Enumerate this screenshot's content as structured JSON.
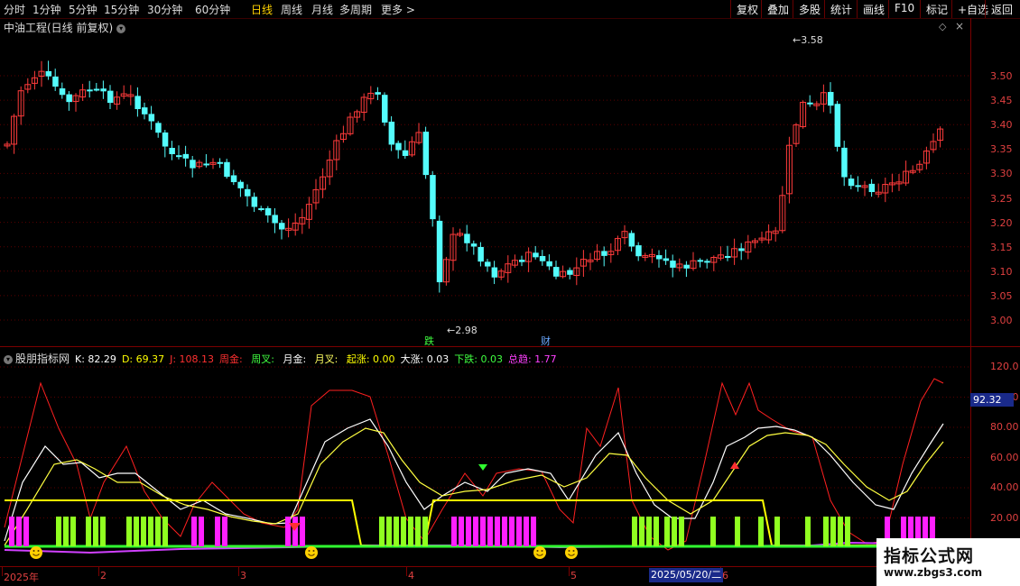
{
  "toolbar": {
    "left": [
      "分时",
      "1分钟",
      "5分钟",
      "15分钟",
      "30分钟",
      "60分钟",
      "日线",
      "周线",
      "月线",
      "多周期",
      "更多 >"
    ],
    "active": "日线",
    "right": [
      "复权",
      "叠加",
      "多股",
      "统计",
      "画线",
      "F10",
      "标记",
      "+自选",
      "返回"
    ]
  },
  "main_chart": {
    "title": "中油工程(日线 前复权)",
    "high_label": "3.58",
    "low_label": "2.98",
    "marker_die": "跌",
    "marker_cai": "财",
    "y_ticks": [
      "3.50",
      "3.45",
      "3.40",
      "3.35",
      "3.30",
      "3.25",
      "3.20",
      "3.15",
      "3.10",
      "3.05",
      "3.00"
    ],
    "colors": {
      "up": "#ff3b3b",
      "down": "#54fcfc"
    }
  },
  "indicator": {
    "name": "股朋指标网",
    "items": [
      {
        "label": "K:",
        "value": "82.29",
        "color": "#ffffff"
      },
      {
        "label": "D:",
        "value": "69.37",
        "color": "#ffff00"
      },
      {
        "label": "J:",
        "value": "108.13",
        "color": "#ff3030"
      },
      {
        "label": "周金:",
        "value": "",
        "color": "#ff3030"
      },
      {
        "label": "周叉:",
        "value": "",
        "color": "#40ff40"
      },
      {
        "label": "月金:",
        "value": "",
        "color": "#ffffff"
      },
      {
        "label": "月叉:",
        "value": "",
        "color": "#ffff60"
      },
      {
        "label": "起涨:",
        "value": "0.00",
        "color": "#ffff00"
      },
      {
        "label": "大涨:",
        "value": "0.03",
        "color": "#ffffff"
      },
      {
        "label": "下跌:",
        "value": "0.03",
        "color": "#40ff40"
      },
      {
        "label": "总趋:",
        "value": "1.77",
        "color": "#ff40ff"
      }
    ],
    "y_ticks": [
      "120.0",
      "100.0",
      "80.00",
      "60.00",
      "40.00",
      "20.00"
    ],
    "current_value": "92.32"
  },
  "x_axis": {
    "labels": [
      "2025年",
      "2",
      "3",
      "4",
      "5",
      "6"
    ],
    "cursor_date": "2025/05/20/二"
  },
  "watermark": {
    "title": "指标公式网",
    "url": "www.zbgs3.com"
  }
}
